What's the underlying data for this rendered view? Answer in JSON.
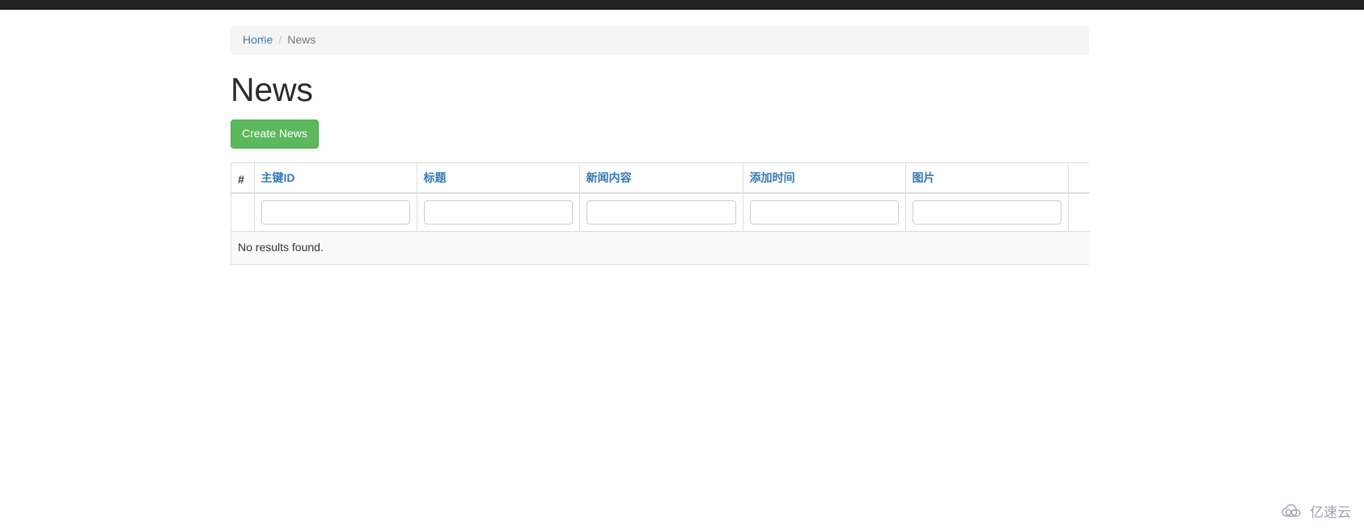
{
  "window": {
    "navbar_color": "#222222"
  },
  "breadcrumb": {
    "home_label": "Home",
    "separator": "/",
    "current_label": "News"
  },
  "page": {
    "title": "News"
  },
  "toolbar": {
    "create_label": "Create News",
    "create_color": "#5cb85c"
  },
  "grid": {
    "columns": [
      {
        "key": "num",
        "label": "#"
      },
      {
        "key": "id",
        "label": "主键ID"
      },
      {
        "key": "title",
        "label": "标题"
      },
      {
        "key": "content",
        "label": "新闻内容"
      },
      {
        "key": "time",
        "label": "添加时间"
      },
      {
        "key": "image",
        "label": "图片"
      },
      {
        "key": "actions",
        "label": ""
      }
    ],
    "filters": [
      {
        "key": "id",
        "value": "",
        "placeholder": ""
      },
      {
        "key": "title",
        "value": "",
        "placeholder": ""
      },
      {
        "key": "content",
        "value": "",
        "placeholder": ""
      },
      {
        "key": "time",
        "value": "",
        "placeholder": ""
      },
      {
        "key": "image",
        "value": "",
        "placeholder": ""
      }
    ],
    "rows": [],
    "empty_message": "No results found.",
    "header_link_color": "#337ab7"
  },
  "watermark": {
    "text": "亿速云",
    "icon": "cloud-icon"
  }
}
